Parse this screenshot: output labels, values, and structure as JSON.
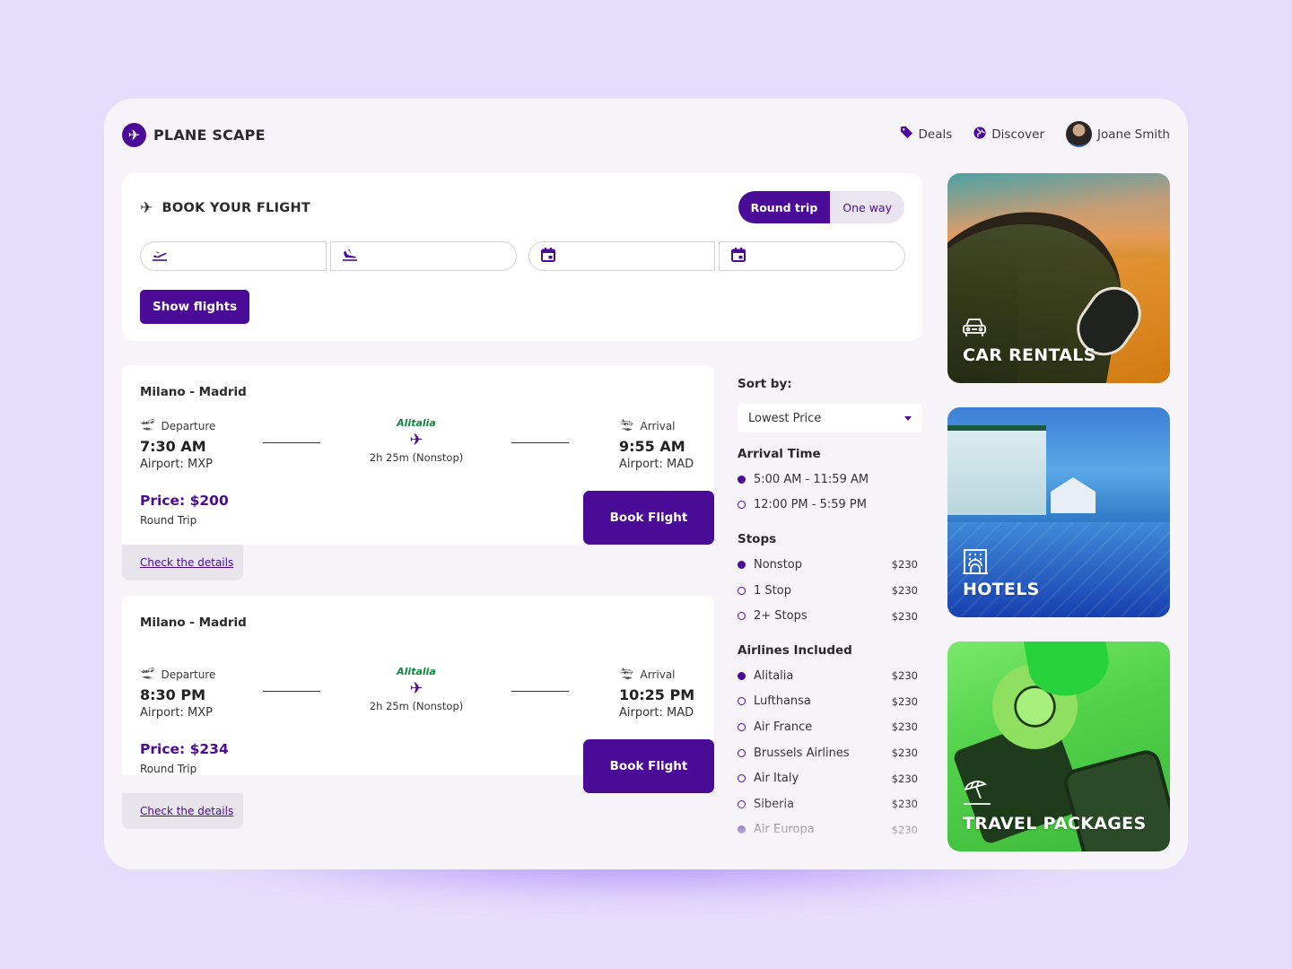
{
  "app": {
    "brand": "PLANE SCAPE"
  },
  "nav": {
    "items": [
      {
        "label": "Deals",
        "icon": "tag-icon"
      },
      {
        "label": "Discover",
        "icon": "globe-icon"
      }
    ],
    "user": {
      "name": "Joane Smith"
    }
  },
  "booking": {
    "title": "BOOK YOUR FLIGHT",
    "trip_types": {
      "selected": "Round trip",
      "options": [
        "Round trip",
        "One way"
      ]
    },
    "fields": {
      "from": {
        "value": "",
        "icon": "takeoff-icon"
      },
      "to": {
        "value": "",
        "icon": "landing-icon"
      },
      "depart_date": {
        "value": "",
        "icon": "calendar-icon"
      },
      "return_date": {
        "value": "",
        "icon": "calendar-icon"
      }
    },
    "show_button": "Show flights"
  },
  "flights": [
    {
      "route": "Milano - Madrid",
      "departure": {
        "label": "Departure",
        "time": "7:30 AM",
        "airport": "Airport: MXP"
      },
      "airline": "Alitalia",
      "duration": "2h 25m (Nonstop)",
      "arrival": {
        "label": "Arrival",
        "time": "9:55 AM",
        "airport": "Airport: MAD"
      },
      "price": "Price: $200",
      "trip": "Round Trip",
      "book_label": "Book Flight",
      "details_label": "Check the details"
    },
    {
      "route": "Milano - Madrid",
      "departure": {
        "label": "Departure",
        "time": "8:30 PM",
        "airport": "Airport: MXP"
      },
      "airline": "Alitalia",
      "duration": "2h 25m (Nonstop)",
      "arrival": {
        "label": "Arrival",
        "time": "10:25 PM",
        "airport": "Airport: MAD"
      },
      "price": "Price: $234",
      "trip": "Round Trip",
      "book_label": "Book Flight",
      "details_label": "Check the details"
    }
  ],
  "filters": {
    "sort_label": "Sort by:",
    "sort_value": "Lowest Price",
    "arrival_time": {
      "title": "Arrival Time",
      "options": [
        {
          "label": "5:00 AM - 11:59 AM",
          "selected": true
        },
        {
          "label": "12:00 PM - 5:59 PM",
          "selected": false
        }
      ]
    },
    "stops": {
      "title": "Stops",
      "options": [
        {
          "label": "Nonstop",
          "price": "$230",
          "selected": true
        },
        {
          "label": "1 Stop",
          "price": "$230",
          "selected": false
        },
        {
          "label": "2+ Stops",
          "price": "$230",
          "selected": false
        }
      ]
    },
    "airlines": {
      "title": "Airlines Included",
      "options": [
        {
          "label": "Alitalia",
          "price": "$230",
          "selected": true
        },
        {
          "label": "Lufthansa",
          "price": "$230",
          "selected": false
        },
        {
          "label": "Air France",
          "price": "$230",
          "selected": false
        },
        {
          "label": "Brussels Airlines",
          "price": "$230",
          "selected": false
        },
        {
          "label": "Air Italy",
          "price": "$230",
          "selected": false
        },
        {
          "label": "Siberia",
          "price": "$230",
          "selected": false
        },
        {
          "label": "Air Europa",
          "price": "$230",
          "selected": true
        }
      ]
    }
  },
  "tiles": [
    {
      "label": "CAR RENTALS",
      "icon": "car-icon"
    },
    {
      "label": "HOTELS",
      "icon": "hotel-icon"
    },
    {
      "label": "TRAVEL PACKAGES",
      "icon": "beach-umbrella-icon"
    }
  ],
  "colors": {
    "brand": "#4a0b97",
    "background": "#e6dcfb",
    "panel": "#f6f4f9",
    "airline_green": "#0b8a3c"
  }
}
